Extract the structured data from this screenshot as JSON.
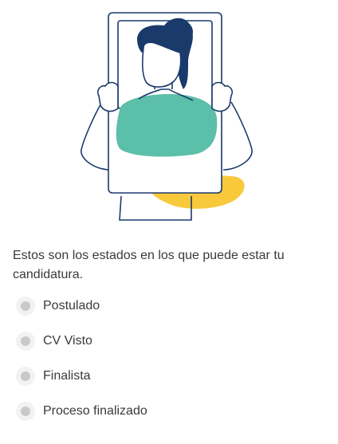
{
  "intro": {
    "text": "Estos son los estados en los que puede estar tu candidatura."
  },
  "statuses": [
    {
      "label": "Postulado"
    },
    {
      "label": "CV Visto"
    },
    {
      "label": "Finalista"
    },
    {
      "label": "Proceso finalizado"
    }
  ],
  "colors": {
    "navy": "#1a3a6b",
    "teal": "#5bbfa9",
    "yellow": "#f9c93c",
    "inactive_dot": "#c9c9c9",
    "dot_ring": "#f2f2f2",
    "text": "#3a3a3a"
  }
}
